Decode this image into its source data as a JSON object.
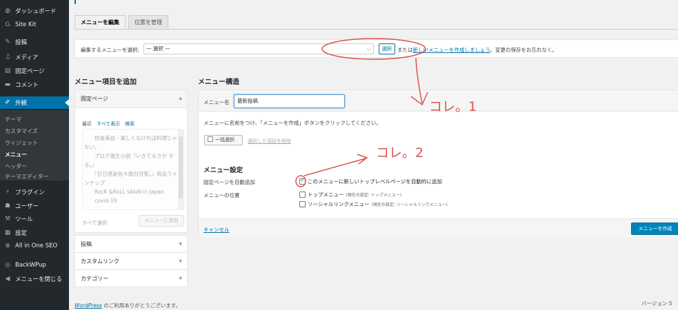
{
  "sidebar": {
    "items": [
      {
        "icon": "dashboard-icon",
        "glyph": "◍",
        "label": "ダッシュボード"
      },
      {
        "icon": "site-kit-icon",
        "glyph": "G",
        "label": "Site Kit"
      },
      {
        "icon": "pin-icon",
        "glyph": "✎",
        "label": "投稿"
      },
      {
        "icon": "media-icon",
        "glyph": "♫",
        "label": "メディア"
      },
      {
        "icon": "page-icon",
        "glyph": "▤",
        "label": "固定ページ"
      },
      {
        "icon": "comment-icon",
        "glyph": "▬",
        "label": "コメント"
      },
      {
        "icon": "appearance-icon",
        "glyph": "✐",
        "label": "外観"
      },
      {
        "icon": "plugin-icon",
        "glyph": "⚡",
        "label": "プラグイン"
      },
      {
        "icon": "users-icon",
        "glyph": "☗",
        "label": "ユーザー"
      },
      {
        "icon": "tools-icon",
        "glyph": "⚒",
        "label": "ツール"
      },
      {
        "icon": "settings-icon",
        "glyph": "▦",
        "label": "設定"
      },
      {
        "icon": "seo-icon",
        "glyph": "⊕",
        "label": "All in One SEO"
      },
      {
        "icon": "backup-icon",
        "glyph": "◎",
        "label": "BackWPup"
      },
      {
        "icon": "collapse-icon",
        "glyph": "◀",
        "label": "メニューを閉じる"
      }
    ],
    "submenu": [
      "テーマ",
      "カスタマイズ",
      "ウィジェット",
      "メニュー",
      "ヘッダー",
      "テーマエディター"
    ]
  },
  "tabs": {
    "edit": "メニューを編集",
    "manage": "位置を管理"
  },
  "manage": {
    "label": "編集するメニューを選択:",
    "selected": "— 選択 —",
    "select_button": "選択",
    "or_text": "または",
    "create_link": "新しいメニューを作成しましょう",
    "save_note": "。変更の保存をお忘れなく。"
  },
  "add_items": {
    "heading": "メニュー項目を追加",
    "section_pages": "固定ページ",
    "subtabs": [
      "最近",
      "すべて表示",
      "検索"
    ],
    "pages": [
      "快食美談・楽しくなければ料理じゃない。",
      "ブログ風生小説『いきてるさが する。』",
      "『日日感是色々面白可笑。』商品ラインナップ",
      "RocK &RoLL sAloN in Japan",
      "covid-19"
    ],
    "select_all": "すべて選択",
    "add_button": "メニューに追加",
    "sections": [
      "投稿",
      "カスタムリンク",
      "カテゴリー"
    ]
  },
  "structure": {
    "heading": "メニュー構造",
    "name_label": "メニュー名",
    "name_value": "最新投稿",
    "instruction": "メニューに名前をつけ、「メニューを作成」ボタンをクリックしてください。",
    "bulk_select": "一括選択",
    "delete_selected": "選択した項目を削除",
    "settings_heading": "メニュー設定",
    "auto_add_label": "固定ページを自動追加",
    "auto_add_option": "このメニューに新しいトップレベルページを自動的に追加",
    "location_label": "メニューの位置",
    "locations": [
      {
        "label": "トップメニュー",
        "note": "(現在の設定: トップメニュー)"
      },
      {
        "label": "ソーシャルリンクメニュー",
        "note": "(現在の設定: ソーシャルリンクメニュー)"
      }
    ],
    "cancel": "キャンセル",
    "create_button": "メニューを作成"
  },
  "footer": {
    "wordpress": "WordPress",
    "thanks": " のご利用ありがとうございます。",
    "version": "バージョン 5"
  },
  "annotations": {
    "note1": "コレ。1",
    "note2": "コレ。2"
  },
  "colors": {
    "accent": "#0073aa",
    "annotation": "#d9534f",
    "sidebar": "#23282d"
  }
}
